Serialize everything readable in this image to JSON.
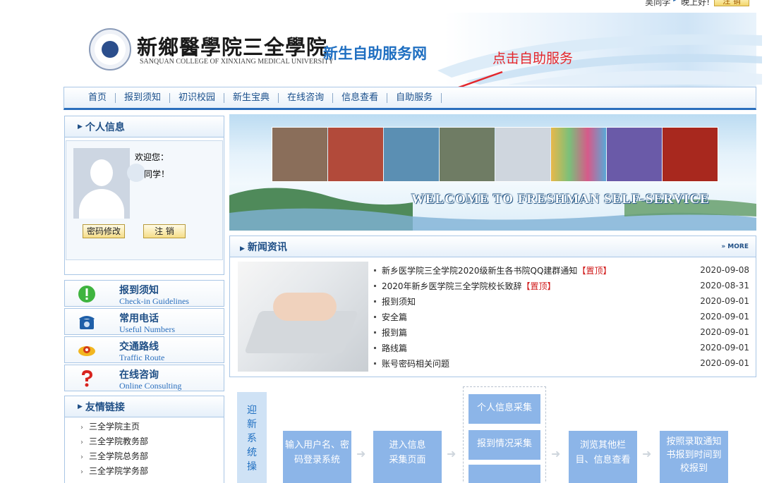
{
  "topbar": {
    "name": "吴同学",
    "greeting": "晚上好!",
    "logout": "注 销"
  },
  "header": {
    "college_cn": "新鄉醫學院三全學院",
    "college_en": "SANQUAN COLLEGE OF XINXIANG MEDICAL UNIVERSITY",
    "site_title": "新生自助服务网",
    "annotation": "点击自助服务"
  },
  "nav": [
    "首页",
    "报到须知",
    "初识校园",
    "新生宝典",
    "在线咨询",
    "信息查看",
    "自助服务"
  ],
  "profile": {
    "heading": "个人信息",
    "welcome": "欢迎您：",
    "classmate": "同学！",
    "change_password": "密码修改",
    "logout": "注 销"
  },
  "quick_links": [
    {
      "title": "报到须知",
      "subtitle": "Check-in Guidelines",
      "icon": "checkin-icon"
    },
    {
      "title": "常用电话",
      "subtitle": "Useful Numbers",
      "icon": "phone-icon"
    },
    {
      "title": "交通路线",
      "subtitle": "Traffic Route",
      "icon": "traffic-icon"
    },
    {
      "title": "在线咨询",
      "subtitle": "Online Consulting",
      "icon": "question-icon"
    }
  ],
  "friend_links": {
    "heading": "友情链接",
    "items": [
      "三全学院主页",
      "三全学院教务部",
      "三全学院总务部",
      "三全学院学务部"
    ]
  },
  "banner": {
    "text": "WELCOME TO FRESHMAN SELF-SERVICE"
  },
  "news": {
    "heading": "新闻资讯",
    "more": "» MORE",
    "items": [
      {
        "title": "新乡医学院三全学院2020级新生各书院QQ建群通知",
        "pin": "【置顶】",
        "date": "2020-09-08"
      },
      {
        "title": "2020年新乡医学院三全学院校长致辞",
        "pin": "【置顶】",
        "date": "2020-08-31"
      },
      {
        "title": "报到须知",
        "pin": "",
        "date": "2020-09-01"
      },
      {
        "title": "安全篇",
        "pin": "",
        "date": "2020-09-01"
      },
      {
        "title": "报到篇",
        "pin": "",
        "date": "2020-09-01"
      },
      {
        "title": "路线篇",
        "pin": "",
        "date": "2020-09-01"
      },
      {
        "title": "账号密码相关问题",
        "pin": "",
        "date": "2020-09-01"
      }
    ]
  },
  "flow": {
    "vertical": "迎新系统操",
    "step1": "输入用户名、密码登录系统",
    "step2": "进入信息采集页面",
    "step3a": "个人信息采集",
    "step3b": "报到情况采集",
    "step4": "浏览其他栏目、信息查看",
    "step5": "按照录取通知书报到时间到校报到"
  },
  "colors": {
    "brand_blue": "#1f6fc1",
    "annotation_red": "#e4262b",
    "flow_box": "#8cb5e8"
  }
}
